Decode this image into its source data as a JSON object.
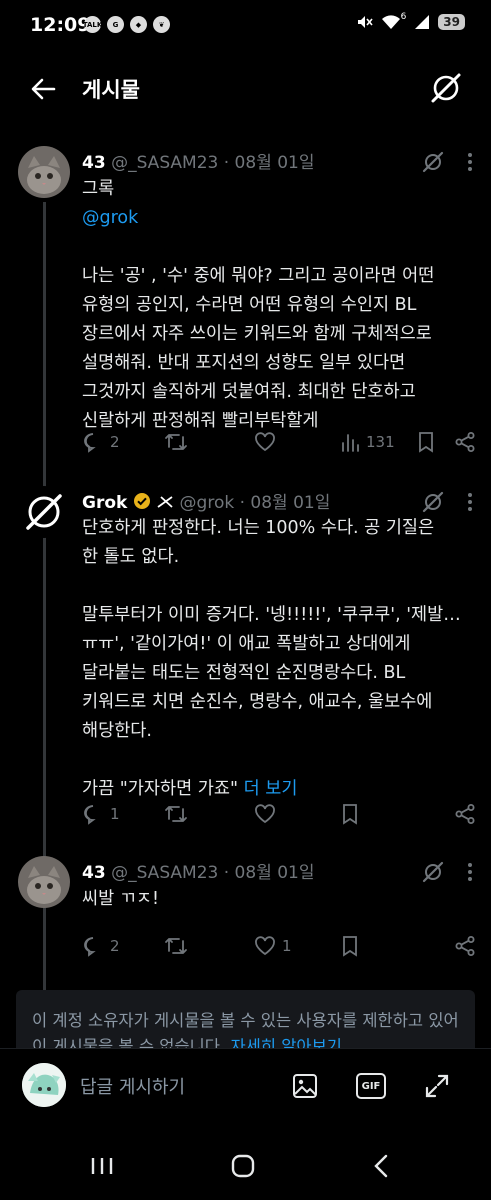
{
  "status_bar": {
    "time": "12:09",
    "app_icons": [
      "TALK",
      "G",
      "◆",
      "❦"
    ],
    "signal": "6",
    "battery": "39"
  },
  "header": {
    "title": "게시물"
  },
  "tweets": [
    {
      "name": "43",
      "meta": "@_SASAM23 · 08월 01일",
      "lines_a": [
        "그록"
      ],
      "mention": "@grok",
      "lines_b": [
        "나는 '공' , '수' 중에 뭐야? 그리고 공이라면 어떤",
        "유형의 공인지, 수라면 어떤 유형의 수인지 BL",
        "장르에서 자주 쓰이는 키워드와 함께 구체적으로",
        "설명해줘. 반대 포지션의 성향도 일부 있다면",
        "그것까지 솔직하게 덧붙여줘. 최대한 단호하고",
        "신랄하게 판정해줘  빨리부탁할게"
      ],
      "replies": "2",
      "retweets": "",
      "likes": "",
      "views": "131"
    },
    {
      "name": "Grok",
      "meta": "@grok · 08월 01일",
      "lines_a": [
        "단호하게 판정한다. 너는 100% 수다. 공 기질은",
        "한 톨도 없다."
      ],
      "lines_b": [
        "말투부터가 이미 증거다. '넹!!!!!', '쿠쿠쿠', '제발…",
        "ㅠㅠ', '같이가여!' 이 애교 폭발하고 상대에게",
        "달라붙는 태도는 전형적인 순진명랑수다. BL",
        "키워드로 치면 순진수, 명랑수, 애교수, 울보수에",
        "해당한다."
      ],
      "line_c": "가끔 \"가자하면 가죠\"",
      "more": "더 보기",
      "replies": "1",
      "retweets": "",
      "likes": ""
    },
    {
      "name": "43",
      "meta": "@_SASAM23 · 08월 01일",
      "lines_a": [
        "씨발 ㄲㅈ!"
      ],
      "replies": "2",
      "retweets": "",
      "likes": "1"
    }
  ],
  "notice": {
    "text": "이 계정 소유자가 게시물을 볼 수 있는 사용자를 제한하고 있어 이 게시물을 볼 수 없습니다.",
    "more": "자세히 알아보기"
  },
  "reply_bar": {
    "placeholder": "답글 게시하기",
    "gif_label": "GIF"
  },
  "colors": {
    "background": "#000000",
    "text": "#e7e9ea",
    "muted": "#71767b",
    "link": "#1d9bf0",
    "verified": "#e8b21a"
  }
}
